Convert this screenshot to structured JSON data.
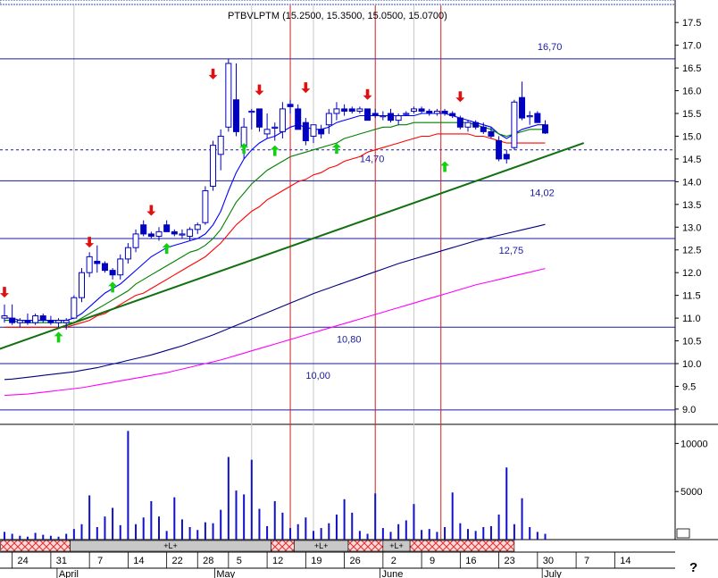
{
  "chart_data": {
    "type": "candlestick",
    "title": "PTBVLPTM (15.2500, 15.3500, 15.0500, 15.0700)",
    "price_axis": {
      "range": [
        8.9,
        17.7
      ],
      "ticks": [
        "17.5",
        "17.0",
        "16.5",
        "16.0",
        "15.5",
        "15.0",
        "14.5",
        "14.0",
        "13.5",
        "13.0",
        "12.5",
        "12.0",
        "11.5",
        "11.0",
        "10.5",
        "10.0",
        "9.5",
        "9.0"
      ]
    },
    "volume_axis": {
      "range": [
        0,
        11800
      ],
      "ticks": [
        "10000",
        "5000"
      ]
    },
    "x_ticks": [
      {
        "label": "24",
        "i": 1
      },
      {
        "label": "31",
        "i": 6
      },
      {
        "label": "7",
        "i": 11
      },
      {
        "label": "14",
        "i": 16
      },
      {
        "label": "22",
        "i": 21
      },
      {
        "label": "28",
        "i": 25
      },
      {
        "label": "5",
        "i": 29
      },
      {
        "label": "12",
        "i": 34
      },
      {
        "label": "19",
        "i": 39
      },
      {
        "label": "26",
        "i": 44
      },
      {
        "label": "2",
        "i": 49
      },
      {
        "label": "9",
        "i": 54
      },
      {
        "label": "16",
        "i": 59
      },
      {
        "label": "23",
        "i": 64
      },
      {
        "label": "30",
        "i": 69
      },
      {
        "label": "7",
        "i": 74
      },
      {
        "label": "14",
        "i": 79
      }
    ],
    "months": [
      {
        "label": "April",
        "i": 8.2
      },
      {
        "label": "May",
        "i": 28.6
      },
      {
        "label": "June",
        "i": 50
      },
      {
        "label": "July",
        "i": 71
      }
    ],
    "levels": [
      {
        "value": 16.7,
        "label": "16,70"
      },
      {
        "value": 14.7,
        "label": "14,70",
        "dashed": true
      },
      {
        "value": 14.02,
        "label": "14,02"
      },
      {
        "value": 12.75,
        "label": "12,75"
      },
      {
        "value": 10.8,
        "label": "10,80"
      },
      {
        "value": 10.0,
        "label": "10,00"
      },
      {
        "value": 8.98,
        "label": ""
      }
    ],
    "trendline": {
      "from": [
        -1,
        10.3
      ],
      "to": [
        75,
        14.85
      ]
    },
    "vertical_lines_red": [
      37,
      48,
      56.5
    ],
    "vertical_lines_grey": [
      9,
      32,
      40,
      53
    ],
    "candles": [
      [
        11.0,
        11.3,
        10.9,
        11.05
      ],
      [
        11.0,
        11.3,
        10.85,
        10.9
      ],
      [
        10.9,
        11.0,
        10.8,
        10.95
      ],
      [
        10.95,
        11.1,
        10.85,
        10.9
      ],
      [
        10.9,
        11.1,
        10.85,
        11.05
      ],
      [
        11.05,
        11.1,
        10.9,
        10.95
      ],
      [
        10.95,
        11.05,
        10.85,
        10.9
      ],
      [
        10.9,
        11.0,
        10.8,
        10.95
      ],
      [
        10.9,
        11.0,
        10.75,
        10.95
      ],
      [
        11.0,
        11.5,
        11.0,
        11.45
      ],
      [
        11.45,
        12.1,
        11.35,
        12.0
      ],
      [
        12.0,
        12.45,
        11.9,
        12.35
      ],
      [
        12.25,
        12.6,
        12.0,
        12.2
      ],
      [
        12.2,
        12.25,
        12.0,
        12.05
      ],
      [
        12.05,
        12.1,
        11.85,
        11.95
      ],
      [
        11.95,
        12.4,
        11.85,
        12.3
      ],
      [
        12.3,
        12.65,
        12.2,
        12.55
      ],
      [
        12.55,
        12.95,
        12.45,
        12.85
      ],
      [
        13.05,
        13.15,
        12.8,
        12.85
      ],
      [
        12.85,
        12.9,
        12.75,
        12.8
      ],
      [
        12.8,
        13.0,
        12.7,
        12.9
      ],
      [
        13.05,
        13.15,
        12.9,
        12.9
      ],
      [
        12.9,
        12.95,
        12.8,
        12.85
      ],
      [
        12.85,
        12.95,
        12.75,
        12.85
      ],
      [
        12.8,
        13.0,
        12.7,
        12.95
      ],
      [
        12.95,
        13.1,
        12.85,
        13.05
      ],
      [
        13.1,
        13.9,
        13.05,
        13.8
      ],
      [
        13.9,
        14.9,
        13.8,
        14.8
      ],
      [
        14.6,
        15.15,
        14.25,
        15.0
      ],
      [
        15.2,
        16.7,
        15.1,
        16.6
      ],
      [
        15.8,
        16.6,
        15.0,
        15.1
      ],
      [
        14.8,
        15.4,
        14.5,
        15.2
      ],
      [
        15.55,
        15.6,
        15.15,
        15.55
      ],
      [
        15.6,
        15.6,
        15.1,
        15.2
      ],
      [
        15.05,
        15.5,
        14.95,
        15.15
      ],
      [
        15.2,
        15.3,
        14.9,
        15.2
      ],
      [
        15.1,
        15.75,
        14.95,
        15.6
      ],
      [
        15.7,
        15.8,
        15.5,
        15.65
      ],
      [
        15.6,
        15.7,
        15.15,
        15.15
      ],
      [
        15.3,
        15.4,
        14.8,
        14.9
      ],
      [
        15.0,
        15.25,
        14.85,
        15.25
      ],
      [
        15.15,
        15.25,
        14.95,
        15.05
      ],
      [
        15.25,
        15.6,
        15.05,
        15.5
      ],
      [
        15.5,
        15.75,
        15.35,
        15.6
      ],
      [
        15.6,
        15.7,
        15.45,
        15.55
      ],
      [
        15.6,
        15.65,
        15.5,
        15.55
      ],
      [
        15.55,
        15.65,
        15.5,
        15.6
      ],
      [
        15.6,
        15.6,
        15.35,
        15.35
      ],
      [
        15.5,
        15.6,
        15.4,
        15.45
      ],
      [
        15.45,
        15.55,
        15.35,
        15.45
      ],
      [
        15.5,
        15.6,
        15.3,
        15.35
      ],
      [
        15.35,
        15.5,
        15.25,
        15.45
      ],
      [
        15.5,
        15.55,
        15.45,
        15.5
      ],
      [
        15.55,
        15.65,
        15.5,
        15.6
      ],
      [
        15.6,
        15.65,
        15.5,
        15.55
      ],
      [
        15.55,
        15.6,
        15.45,
        15.5
      ],
      [
        15.5,
        15.6,
        15.45,
        15.55
      ],
      [
        15.55,
        15.6,
        15.45,
        15.5
      ],
      [
        15.5,
        15.55,
        15.4,
        15.45
      ],
      [
        15.4,
        15.45,
        15.15,
        15.2
      ],
      [
        15.2,
        15.35,
        15.1,
        15.3
      ],
      [
        15.3,
        15.35,
        15.15,
        15.2
      ],
      [
        15.2,
        15.3,
        15.05,
        15.1
      ],
      [
        15.1,
        15.2,
        14.95,
        15.0
      ],
      [
        14.9,
        15.0,
        14.45,
        14.5
      ],
      [
        14.6,
        14.7,
        14.4,
        14.5
      ],
      [
        14.75,
        15.8,
        14.7,
        15.75
      ],
      [
        15.85,
        16.2,
        15.35,
        15.4
      ],
      [
        15.45,
        15.55,
        15.25,
        15.45
      ],
      [
        15.5,
        15.55,
        15.3,
        15.3
      ],
      [
        15.25,
        15.35,
        15.05,
        15.07
      ]
    ],
    "volume": [
      800,
      600,
      400,
      300,
      700,
      500,
      400,
      300,
      600,
      1100,
      1600,
      4600,
      1300,
      2400,
      3300,
      1500,
      11300,
      1600,
      2300,
      4000,
      2400,
      900,
      4400,
      2100,
      1300,
      1000,
      1800,
      1700,
      3100,
      8600,
      5100,
      4700,
      8300,
      3200,
      1400,
      4000,
      2800,
      1200,
      1600,
      2300,
      900,
      1200,
      1700,
      2600,
      4200,
      2800,
      900,
      600,
      4800,
      1200,
      800,
      1600,
      2000,
      3700,
      1000,
      1100,
      800,
      1300,
      4900,
      1700,
      1100,
      900,
      1300,
      1400,
      2600,
      7500,
      1600,
      4300,
      1300,
      800,
      600
    ],
    "indicator_lines": [
      {
        "color": "#0000ff",
        "values": [
          11.0,
          11.0,
          10.95,
          10.95,
          10.95,
          10.95,
          10.95,
          10.95,
          10.95,
          11.0,
          11.1,
          11.25,
          11.4,
          11.55,
          11.65,
          11.75,
          11.9,
          12.05,
          12.2,
          12.35,
          12.45,
          12.55,
          12.6,
          12.65,
          12.7,
          12.75,
          12.85,
          13.05,
          13.35,
          13.8,
          14.2,
          14.5,
          14.7,
          14.85,
          14.95,
          15.0,
          15.1,
          15.2,
          15.25,
          15.2,
          15.15,
          15.15,
          15.2,
          15.3,
          15.35,
          15.4,
          15.45,
          15.45,
          15.45,
          15.45,
          15.45,
          15.45,
          15.45,
          15.45,
          15.5,
          15.5,
          15.5,
          15.5,
          15.45,
          15.4,
          15.35,
          15.3,
          15.25,
          15.2,
          15.05,
          14.95,
          15.05,
          15.15,
          15.2,
          15.25,
          15.25
        ]
      },
      {
        "color": "#008000",
        "values": [
          10.95,
          10.95,
          10.9,
          10.9,
          10.9,
          10.9,
          10.9,
          10.9,
          10.9,
          10.9,
          11.0,
          11.1,
          11.2,
          11.3,
          11.4,
          11.5,
          11.6,
          11.75,
          11.85,
          11.95,
          12.05,
          12.15,
          12.25,
          12.35,
          12.45,
          12.5,
          12.6,
          12.75,
          12.95,
          13.25,
          13.55,
          13.75,
          13.95,
          14.1,
          14.25,
          14.35,
          14.45,
          14.55,
          14.6,
          14.65,
          14.7,
          14.75,
          14.8,
          14.85,
          14.95,
          15.0,
          15.05,
          15.1,
          15.15,
          15.2,
          15.2,
          15.25,
          15.25,
          15.3,
          15.3,
          15.3,
          15.3,
          15.3,
          15.3,
          15.3,
          15.3,
          15.25,
          15.2,
          15.15,
          15.05,
          15.0,
          15.05,
          15.1,
          15.15,
          15.15,
          15.15
        ]
      },
      {
        "color": "#ff0000",
        "values": [
          10.8,
          10.8,
          10.8,
          10.8,
          10.8,
          10.8,
          10.8,
          10.8,
          10.8,
          10.85,
          10.9,
          10.95,
          11.05,
          11.1,
          11.2,
          11.3,
          11.4,
          11.5,
          11.55,
          11.65,
          11.75,
          11.85,
          11.95,
          12.05,
          12.15,
          12.25,
          12.35,
          12.5,
          12.65,
          12.85,
          13.05,
          13.2,
          13.35,
          13.45,
          13.6,
          13.7,
          13.8,
          13.9,
          14.0,
          14.05,
          14.15,
          14.2,
          14.3,
          14.35,
          14.45,
          14.5,
          14.55,
          14.65,
          14.7,
          14.75,
          14.8,
          14.85,
          14.9,
          14.95,
          15.0,
          15.0,
          15.05,
          15.05,
          15.05,
          15.05,
          15.05,
          15.0,
          15.0,
          14.95,
          14.9,
          14.85,
          14.85,
          14.85,
          14.85,
          14.85,
          14.85
        ]
      },
      {
        "color": "#000080",
        "values": [
          9.65,
          9.66,
          9.68,
          9.7,
          9.72,
          9.74,
          9.76,
          9.78,
          9.8,
          9.82,
          9.85,
          9.88,
          9.91,
          9.95,
          9.99,
          10.03,
          10.07,
          10.11,
          10.15,
          10.19,
          10.24,
          10.29,
          10.34,
          10.39,
          10.45,
          10.51,
          10.57,
          10.63,
          10.7,
          10.77,
          10.84,
          10.91,
          10.98,
          11.05,
          11.12,
          11.19,
          11.26,
          11.33,
          11.4,
          11.47,
          11.54,
          11.6,
          11.66,
          11.72,
          11.78,
          11.84,
          11.9,
          11.96,
          12.02,
          12.08,
          12.14,
          12.2,
          12.25,
          12.3,
          12.35,
          12.4,
          12.45,
          12.5,
          12.55,
          12.6,
          12.65,
          12.7,
          12.74,
          12.78,
          12.82,
          12.86,
          12.9,
          12.94,
          12.98,
          13.02,
          13.06
        ]
      },
      {
        "color": "#ff00ff",
        "values": [
          9.3,
          9.31,
          9.32,
          9.33,
          9.35,
          9.37,
          9.39,
          9.41,
          9.43,
          9.45,
          9.47,
          9.5,
          9.53,
          9.56,
          9.59,
          9.62,
          9.65,
          9.68,
          9.71,
          9.74,
          9.77,
          9.8,
          9.84,
          9.88,
          9.92,
          9.96,
          10.0,
          10.04,
          10.08,
          10.13,
          10.18,
          10.23,
          10.28,
          10.33,
          10.38,
          10.43,
          10.48,
          10.53,
          10.58,
          10.63,
          10.68,
          10.73,
          10.78,
          10.83,
          10.88,
          10.93,
          10.98,
          11.03,
          11.08,
          11.13,
          11.18,
          11.23,
          11.28,
          11.33,
          11.38,
          11.43,
          11.48,
          11.53,
          11.58,
          11.63,
          11.68,
          11.73,
          11.77,
          11.81,
          11.85,
          11.89,
          11.93,
          11.97,
          12.01,
          12.05,
          12.09
        ]
      }
    ],
    "signals": [
      {
        "i": 0,
        "type": "sell",
        "price": 11.45
      },
      {
        "i": 7,
        "type": "buy",
        "price": 10.7
      },
      {
        "i": 11,
        "type": "sell",
        "price": 12.55
      },
      {
        "i": 14,
        "type": "buy",
        "price": 11.8
      },
      {
        "i": 19,
        "type": "sell",
        "price": 13.25
      },
      {
        "i": 21,
        "type": "buy",
        "price": 12.65
      },
      {
        "i": 27,
        "type": "sell",
        "price": 16.25
      },
      {
        "i": 31,
        "type": "buy",
        "price": 14.85
      },
      {
        "i": 33,
        "type": "sell",
        "price": 15.9
      },
      {
        "i": 35,
        "type": "buy",
        "price": 14.8
      },
      {
        "i": 39,
        "type": "sell",
        "price": 15.95
      },
      {
        "i": 43,
        "type": "buy",
        "price": 14.85
      },
      {
        "i": 47,
        "type": "sell",
        "price": 15.8
      },
      {
        "i": 57,
        "type": "buy",
        "price": 14.45
      },
      {
        "i": 59,
        "type": "sell",
        "price": 15.75
      }
    ],
    "bands": [
      {
        "from": -0.5,
        "to": 8.5,
        "type": "hatch"
      },
      {
        "from": 8.5,
        "to": 34.5,
        "type": "grey",
        "label": "+L+"
      },
      {
        "from": 34.5,
        "to": 37.5,
        "type": "hatch"
      },
      {
        "from": 37.5,
        "to": 44.5,
        "type": "grey",
        "label": "+L+"
      },
      {
        "from": 44.5,
        "to": 49,
        "type": "hatch"
      },
      {
        "from": 49,
        "to": 52.5,
        "type": "grey",
        "label": "+L+"
      },
      {
        "from": 52.5,
        "to": 66,
        "type": "hatch"
      }
    ],
    "corner_marker": "?"
  }
}
